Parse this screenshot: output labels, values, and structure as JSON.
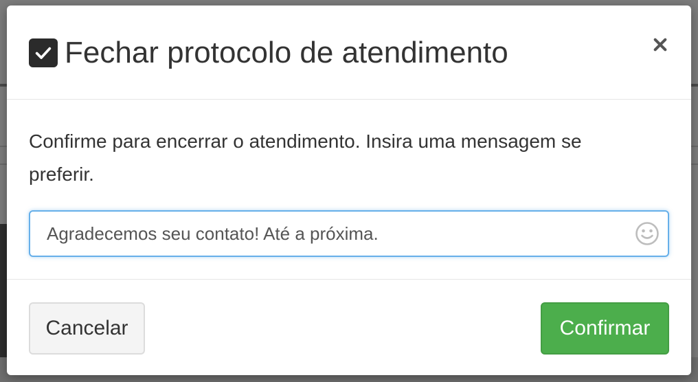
{
  "colors": {
    "accent_confirm": "#4cae4c",
    "input_focus_border": "#66afe9",
    "title_text": "#333333",
    "checkbox_icon_bg": "#2b2b2b"
  },
  "modal": {
    "title_icon": "check-square-icon",
    "title": "Fechar protocolo de atendimento",
    "close_icon": "close-icon",
    "body_text": "Confirme para encerrar o atendimento. Insira uma mensagem se preferir.",
    "message_input": {
      "value": "Agradecemos seu contato! Até a próxima.",
      "emoji_icon": "smiley-icon"
    },
    "buttons": {
      "cancel": "Cancelar",
      "confirm": "Confirmar"
    }
  }
}
